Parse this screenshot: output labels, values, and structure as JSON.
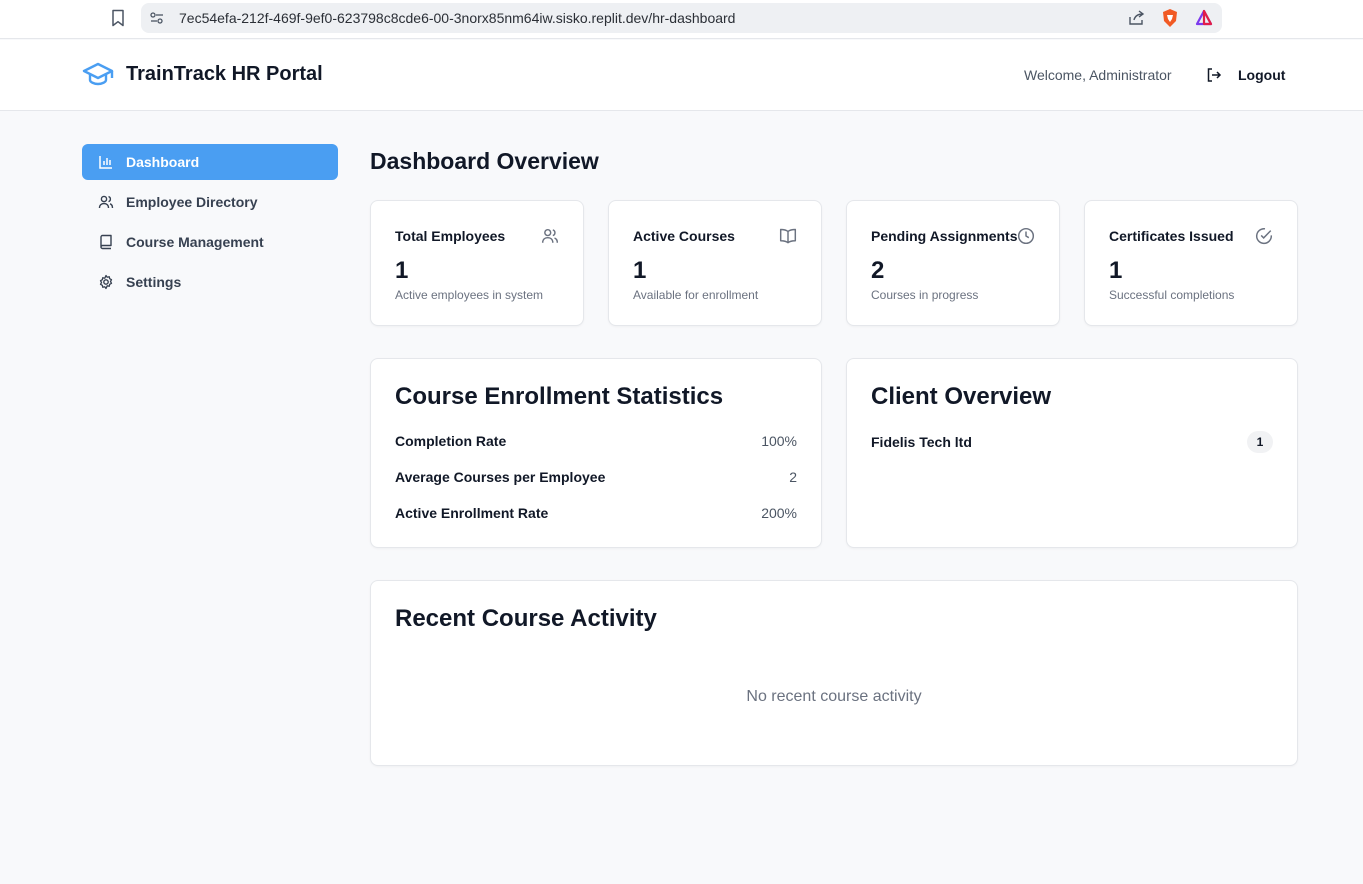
{
  "browser": {
    "url": "7ec54efa-212f-469f-9ef0-623798c8cde6-00-3norx85nm64iw.sisko.replit.dev/hr-dashboard"
  },
  "header": {
    "brand": "TrainTrack HR Portal",
    "welcome": "Welcome, Administrator",
    "logout": "Logout",
    "accent_color": "#4a9ef2"
  },
  "sidebar": {
    "items": [
      {
        "label": "Dashboard",
        "icon": "bar-chart-icon",
        "active": true
      },
      {
        "label": "Employee Directory",
        "icon": "users-icon",
        "active": false
      },
      {
        "label": "Course Management",
        "icon": "book-icon",
        "active": false
      },
      {
        "label": "Settings",
        "icon": "gear-icon",
        "active": false
      }
    ]
  },
  "main": {
    "title": "Dashboard Overview",
    "stats": [
      {
        "title": "Total Employees",
        "value": "1",
        "sub": "Active employees in system",
        "icon": "users-icon"
      },
      {
        "title": "Active Courses",
        "value": "1",
        "sub": "Available for enrollment",
        "icon": "book-open-icon"
      },
      {
        "title": "Pending Assignments",
        "value": "2",
        "sub": "Courses in progress",
        "icon": "clock-icon"
      },
      {
        "title": "Certificates Issued",
        "value": "1",
        "sub": "Successful completions",
        "icon": "check-circle-icon"
      }
    ],
    "enrollment": {
      "title": "Course Enrollment Statistics",
      "rows": [
        {
          "label": "Completion Rate",
          "value": "100%"
        },
        {
          "label": "Average Courses per Employee",
          "value": "2"
        },
        {
          "label": "Active Enrollment Rate",
          "value": "200%"
        }
      ]
    },
    "clients": {
      "title": "Client Overview",
      "items": [
        {
          "name": "Fidelis Tech ltd",
          "count": "1"
        }
      ]
    },
    "activity": {
      "title": "Recent Course Activity",
      "empty": "No recent course activity"
    }
  }
}
